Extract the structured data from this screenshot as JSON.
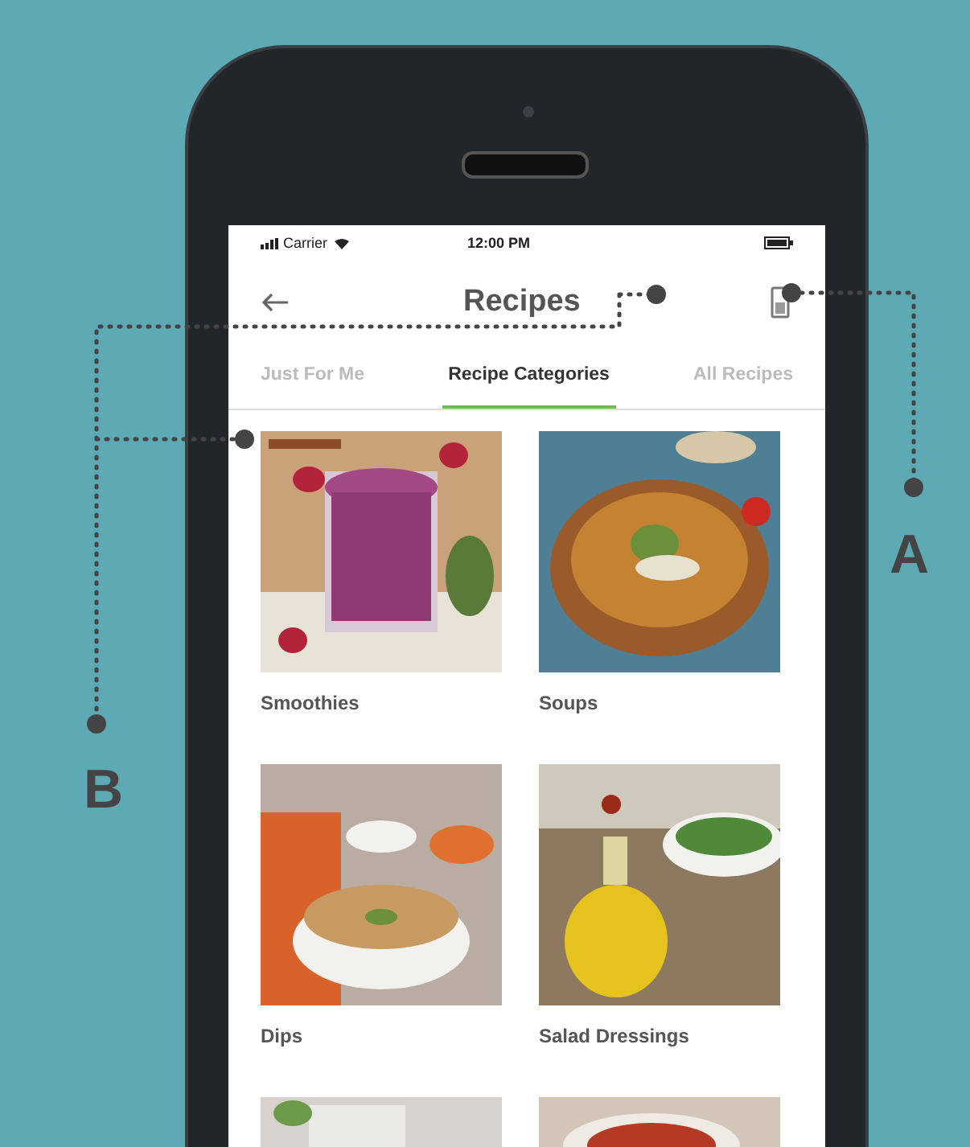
{
  "status_bar": {
    "carrier": "Carrier",
    "time": "12:00 PM"
  },
  "header": {
    "title": "Recipes"
  },
  "tabs": [
    {
      "label": "Just For Me",
      "selected": false
    },
    {
      "label": "Recipe Categories",
      "selected": true
    },
    {
      "label": "All Recipes",
      "selected": false
    }
  ],
  "categories": [
    {
      "label": "Smoothies"
    },
    {
      "label": "Soups"
    },
    {
      "label": "Dips"
    },
    {
      "label": "Salad Dressings"
    }
  ],
  "callouts": [
    {
      "label": "A"
    },
    {
      "label": "B"
    }
  ]
}
